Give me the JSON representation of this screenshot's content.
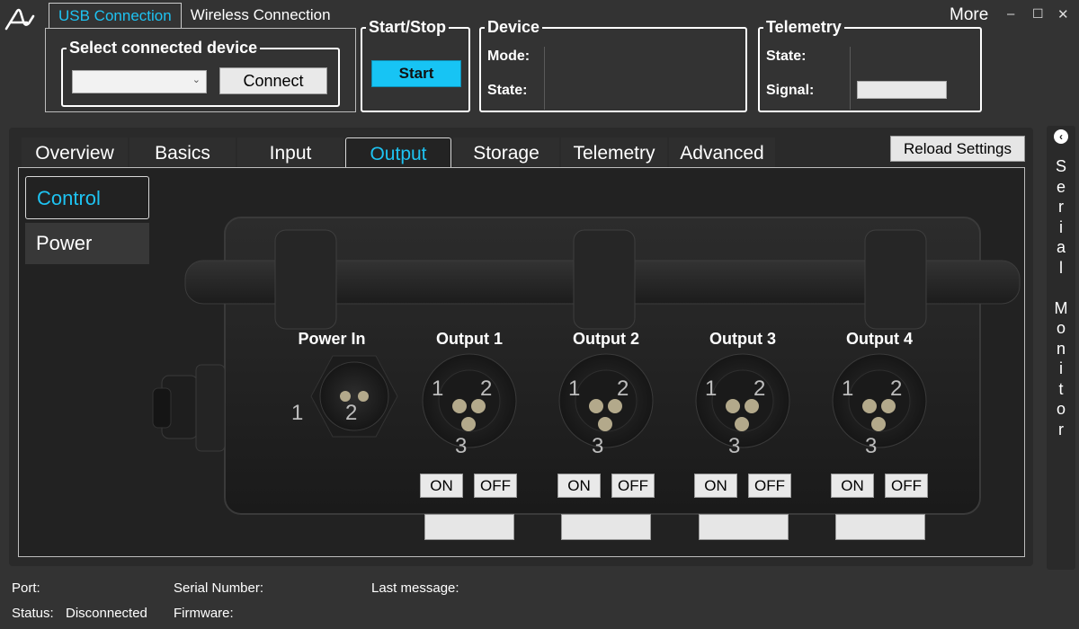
{
  "connection": {
    "tabs": [
      "USB Connection",
      "Wireless Connection"
    ],
    "active_tab": "USB Connection",
    "select_group_title": "Select connected device",
    "selected_device": "",
    "connect_label": "Connect"
  },
  "start_stop": {
    "title": "Start/Stop",
    "start_label": "Start"
  },
  "device": {
    "title": "Device",
    "mode_label": "Mode:",
    "mode_value": "",
    "state_label": "State:",
    "state_value": ""
  },
  "telemetry": {
    "title": "Telemetry",
    "state_label": "State:",
    "state_value": "",
    "signal_label": "Signal:",
    "signal_value": ""
  },
  "window": {
    "more_label": "More",
    "minimize": "–",
    "maximize": "☐",
    "close": "✕"
  },
  "tabs": [
    "Overview",
    "Basics",
    "Input",
    "Output",
    "Storage",
    "Telemetry",
    "Advanced"
  ],
  "active_tab": "Output",
  "reload_label": "Reload Settings",
  "side_menu": [
    "Control",
    "Power"
  ],
  "active_side": "Control",
  "ports": {
    "power_in": {
      "label": "Power In",
      "pins": [
        "1",
        "2"
      ]
    },
    "outputs": [
      {
        "label": "Output 1",
        "pins": [
          "1",
          "2",
          "3"
        ],
        "on_label": "ON",
        "off_label": "OFF",
        "value": ""
      },
      {
        "label": "Output 2",
        "pins": [
          "1",
          "2",
          "3"
        ],
        "on_label": "ON",
        "off_label": "OFF",
        "value": ""
      },
      {
        "label": "Output 3",
        "pins": [
          "1",
          "2",
          "3"
        ],
        "on_label": "ON",
        "off_label": "OFF",
        "value": ""
      },
      {
        "label": "Output 4",
        "pins": [
          "1",
          "2",
          "3"
        ],
        "on_label": "ON",
        "off_label": "OFF",
        "value": ""
      }
    ]
  },
  "serial_monitor": {
    "label": "Serial Monitor",
    "collapse_icon": "chevron-left-icon"
  },
  "status_bar": {
    "port_label": "Port:",
    "port_value": "",
    "status_label": "Status:",
    "status_value": "Disconnected",
    "serial_label": "Serial Number:",
    "serial_value": "",
    "firmware_label": "Firmware:",
    "firmware_value": "",
    "last_message_label": "Last message:",
    "last_message_value": ""
  },
  "colors": {
    "accent": "#1ec3f2",
    "background": "#333333",
    "panel": "#2a2a2a"
  }
}
